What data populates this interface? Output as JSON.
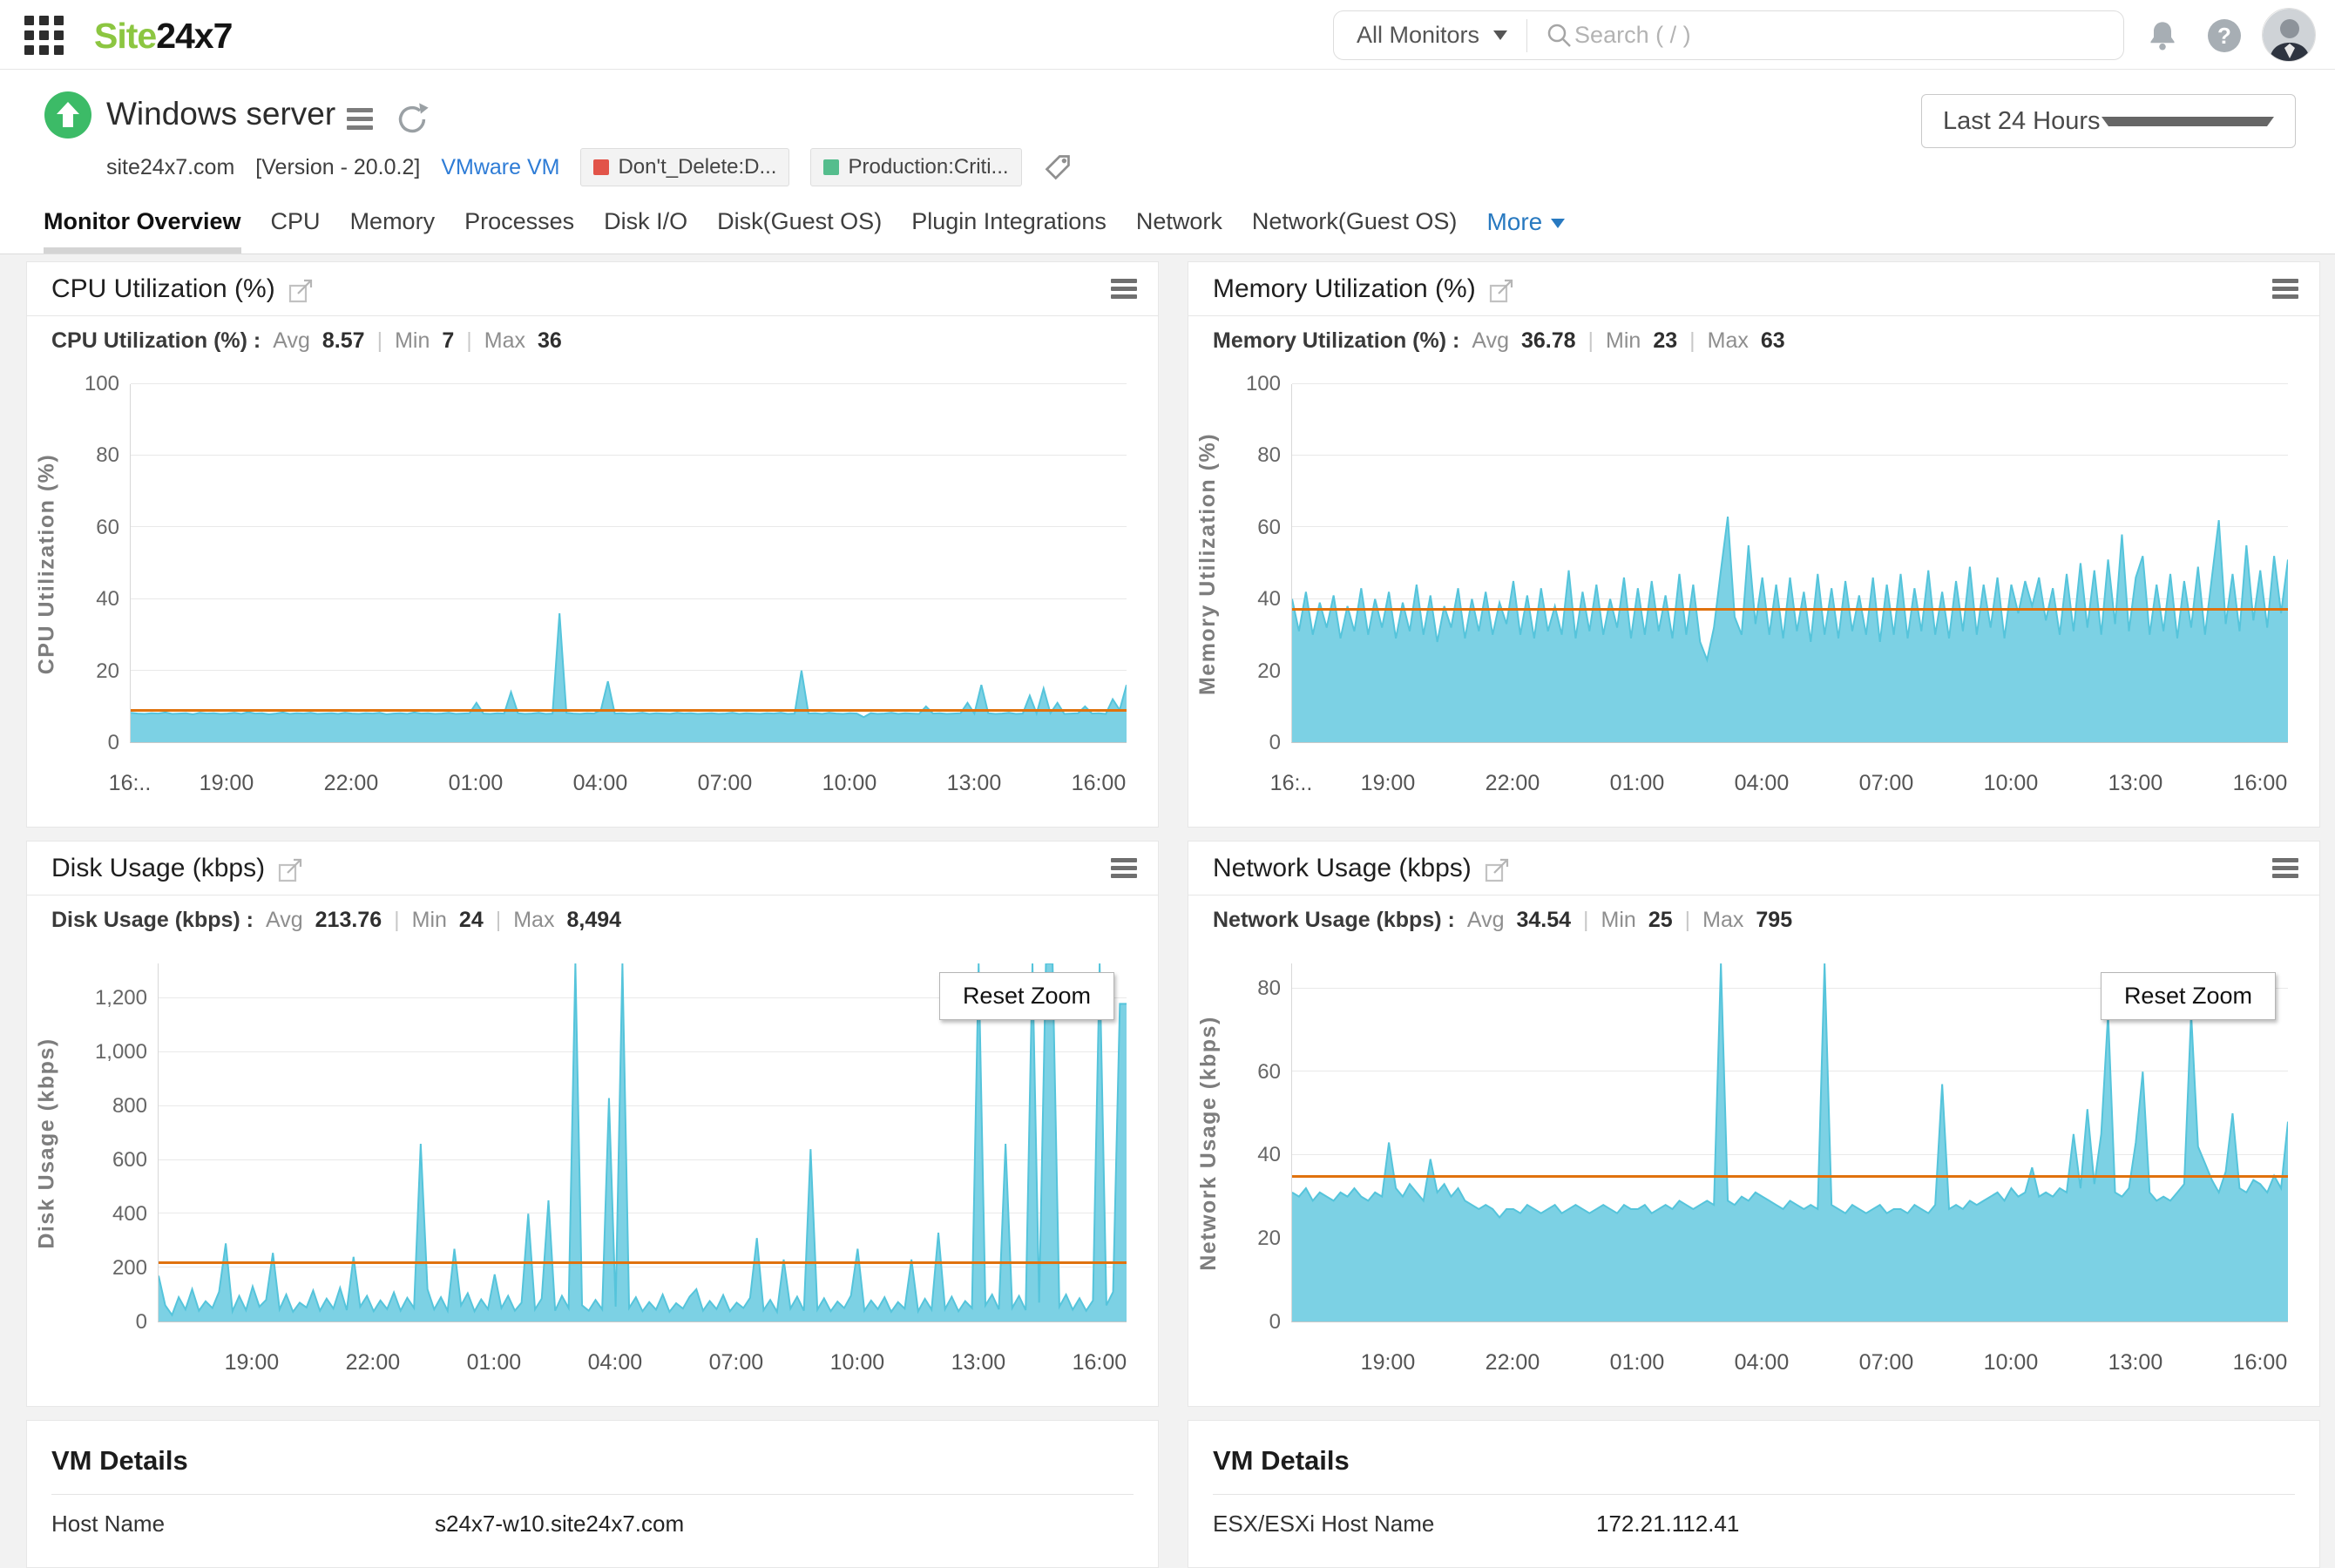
{
  "topbar": {
    "logo_site": "Site",
    "logo_24x7": "24x7",
    "monitors_label": "All Monitors",
    "search_placeholder": "Search ( / )"
  },
  "header": {
    "title": "Windows server",
    "host": "site24x7.com",
    "version": "[Version - 20.0.2]",
    "vm_type": "VMware VM",
    "tags": [
      {
        "label": "Don't_Delete:D...",
        "color": "#E25449"
      },
      {
        "label": "Production:Criti...",
        "color": "#55BD8D"
      }
    ],
    "time_range": "Last 24 Hours"
  },
  "tabs": {
    "items": [
      "Monitor Overview",
      "CPU",
      "Memory",
      "Processes",
      "Disk I/O",
      "Disk(Guest OS)",
      "Plugin Integrations",
      "Network",
      "Network(Guest OS)"
    ],
    "active": "Monitor Overview",
    "more_label": "More"
  },
  "ui": {
    "sep": "|",
    "reset_zoom": "Reset Zoom",
    "help_glyph": "?"
  },
  "colors": {
    "brand_green": "#8CC641",
    "status_up": "#3CBB67",
    "area_fill": "#7CD1E4",
    "area_stroke": "#55C4DB",
    "avg_line": "#E0720E",
    "tag_red": "#E25449",
    "tag_green": "#55BD8D",
    "link_blue": "#2E7CD6",
    "more_blue": "#2879C0"
  },
  "panels": [
    {
      "title": "CPU Utilization (%)",
      "stat_label": "CPU Utilization (%) :",
      "avg_label": "Avg",
      "avg": "8.57",
      "min_label": "Min",
      "min": "7",
      "max_label": "Max",
      "max": "36"
    },
    {
      "title": "Memory Utilization (%)",
      "stat_label": "Memory Utilization (%) :",
      "avg_label": "Avg",
      "avg": "36.78",
      "min_label": "Min",
      "min": "23",
      "max_label": "Max",
      "max": "63"
    },
    {
      "title": "Disk Usage (kbps)",
      "stat_label": "Disk Usage (kbps) :",
      "avg_label": "Avg",
      "avg": "213.76",
      "min_label": "Min",
      "min": "24",
      "max_label": "Max",
      "max": "8,494"
    },
    {
      "title": "Network Usage (kbps)",
      "stat_label": "Network Usage (kbps) :",
      "avg_label": "Avg",
      "avg": "34.54",
      "min_label": "Min",
      "min": "25",
      "max_label": "Max",
      "max": "795"
    }
  ],
  "vm_details": [
    {
      "title": "VM Details",
      "rows": [
        {
          "label": "Host Name",
          "value": "s24x7-w10.site24x7.com"
        }
      ]
    },
    {
      "title": "VM Details",
      "rows": [
        {
          "label": "ESX/ESXi Host Name",
          "value": "172.21.112.41"
        }
      ]
    }
  ],
  "chart_data": [
    {
      "type": "area",
      "title": "CPU Utilization (%)",
      "ylabel": "CPU Utilization (%)",
      "xlabel": "",
      "ylim": [
        0,
        100
      ],
      "yticks": [
        0,
        20,
        40,
        60,
        80,
        100
      ],
      "ytick_labels": [
        "0",
        "20",
        "40",
        "60",
        "80",
        "100"
      ],
      "xtick_labels": [
        "16:..",
        "19:00",
        "22:00",
        "01:00",
        "04:00",
        "07:00",
        "10:00",
        "13:00",
        "16:00"
      ],
      "xtick_fracs": [
        0,
        0.097,
        0.222,
        0.347,
        0.472,
        0.597,
        0.722,
        0.847,
        0.972
      ],
      "avg_line": 8.57,
      "grid": true,
      "legend": "none",
      "values": [
        8.2,
        8,
        7.9,
        8.1,
        8,
        8.3,
        7.9,
        8,
        8.1,
        7.8,
        8.2,
        8,
        8.1,
        7.9,
        8,
        8.2,
        7.9,
        8.4,
        8,
        8.1,
        7.8,
        8,
        8.3,
        7.9,
        8.1,
        8,
        8.2,
        7.9,
        8,
        8.1,
        7.9,
        8.2,
        8,
        7.9,
        8.1,
        8,
        8.2,
        7.8,
        8,
        8.1,
        7.9,
        8.3,
        8,
        8.1,
        7.9,
        8,
        8.2,
        7.9,
        8,
        8.1,
        11,
        8,
        7.9,
        8.1,
        8,
        14,
        8.1,
        7.9,
        8,
        8.2,
        7.9,
        8,
        36,
        8.2,
        8,
        7.9,
        8.1,
        8,
        9,
        17,
        8,
        8.1,
        7.9,
        8,
        8.2,
        7.9,
        8.1,
        8,
        7.9,
        8.2,
        8,
        8.1,
        7.9,
        8,
        8.1,
        7.9,
        8,
        8.2,
        7.9,
        8.1,
        8,
        7.9,
        8.1,
        8,
        8.2,
        7.9,
        8,
        20,
        8,
        8.1,
        7.9,
        8.2,
        8,
        7.9,
        8.1,
        8,
        7,
        8.1,
        7.9,
        8,
        8.2,
        7.9,
        8.1,
        8,
        7.9,
        10,
        8,
        8.1,
        7.9,
        8,
        8.1,
        11,
        8,
        16,
        8.1,
        7.9,
        8,
        8.2,
        7.9,
        8,
        13,
        8,
        15,
        8.1,
        11,
        7.9,
        8,
        8.1,
        10,
        8,
        8.1,
        7.9,
        12,
        9,
        16
      ]
    },
    {
      "type": "area",
      "title": "Memory Utilization (%)",
      "ylabel": "Memory Utilization (%)",
      "xlabel": "",
      "ylim": [
        0,
        100
      ],
      "yticks": [
        0,
        20,
        40,
        60,
        80,
        100
      ],
      "ytick_labels": [
        "0",
        "20",
        "40",
        "60",
        "80",
        "100"
      ],
      "xtick_labels": [
        "16:..",
        "19:00",
        "22:00",
        "01:00",
        "04:00",
        "07:00",
        "10:00",
        "13:00",
        "16:00"
      ],
      "xtick_fracs": [
        0,
        0.097,
        0.222,
        0.347,
        0.472,
        0.597,
        0.722,
        0.847,
        0.972
      ],
      "avg_line": 36.78,
      "grid": true,
      "legend": "none",
      "values": [
        40,
        31,
        42,
        30,
        39,
        32,
        41,
        29,
        38,
        31,
        43,
        30,
        40,
        32,
        42,
        29,
        39,
        31,
        44,
        30,
        41,
        28,
        38,
        32,
        43,
        29,
        40,
        31,
        42,
        30,
        39,
        33,
        45,
        30,
        41,
        29,
        43,
        31,
        38,
        30,
        48,
        29,
        42,
        31,
        44,
        30,
        40,
        32,
        46,
        29,
        43,
        30,
        45,
        31,
        41,
        29,
        47,
        30,
        44,
        28,
        23,
        32,
        48,
        63,
        35,
        30,
        55,
        33,
        46,
        30,
        44,
        29,
        46,
        31,
        42,
        28,
        47,
        30,
        43,
        29,
        45,
        31,
        41,
        30,
        46,
        28,
        44,
        30,
        47,
        29,
        43,
        31,
        48,
        30,
        42,
        29,
        45,
        31,
        49,
        30,
        44,
        32,
        46,
        29,
        44,
        36,
        45,
        38,
        46,
        34,
        43,
        30,
        47,
        31,
        50,
        32,
        48,
        30,
        51,
        33,
        58,
        31,
        46,
        52,
        30,
        44,
        31,
        47,
        29,
        45,
        32,
        49,
        30,
        46,
        62,
        33,
        47,
        31,
        55,
        34,
        48,
        32,
        52,
        36,
        51
      ]
    },
    {
      "type": "area",
      "title": "Disk Usage (kbps)",
      "ylabel": "Disk Usage (kbps)",
      "xlabel": "",
      "ylim": [
        0,
        1330
      ],
      "yticks": [
        0,
        200,
        400,
        600,
        800,
        1000,
        1200
      ],
      "ytick_labels": [
        "0",
        "200",
        "400",
        "600",
        "800",
        "1,000",
        "1,200"
      ],
      "xtick_labels": [
        "19:00",
        "22:00",
        "01:00",
        "04:00",
        "07:00",
        "10:00",
        "13:00",
        "16:00"
      ],
      "xtick_fracs": [
        0.097,
        0.222,
        0.347,
        0.472,
        0.597,
        0.722,
        0.847,
        0.972
      ],
      "avg_line": 213.76,
      "grid": true,
      "legend": "none",
      "zoomed": true,
      "values": [
        170,
        60,
        24,
        90,
        45,
        120,
        40,
        75,
        50,
        110,
        290,
        38,
        95,
        42,
        130,
        55,
        80,
        255,
        45,
        100,
        36,
        70,
        52,
        115,
        40,
        85,
        48,
        125,
        42,
        240,
        55,
        95,
        38,
        78,
        46,
        108,
        40,
        88,
        50,
        660,
        120,
        45,
        90,
        40,
        270,
        60,
        105,
        38,
        82,
        46,
        175,
        50,
        95,
        40,
        70,
        400,
        45,
        85,
        450,
        40,
        95,
        50,
        8494,
        60,
        40,
        80,
        45,
        830,
        55,
        4200,
        50,
        90,
        38,
        72,
        44,
        100,
        36,
        68,
        48,
        92,
        120,
        40,
        76,
        46,
        98,
        38,
        70,
        50,
        88,
        310,
        42,
        80,
        36,
        230,
        48,
        92,
        40,
        640,
        44,
        86,
        38,
        74,
        50,
        96,
        270,
        40,
        78,
        46,
        90,
        36,
        72,
        48,
        230,
        38,
        84,
        44,
        330,
        46,
        92,
        38,
        76,
        50,
        2600,
        60,
        100,
        45,
        660,
        50,
        95,
        42,
        3400,
        70,
        2200,
        1900,
        55,
        100,
        44,
        86,
        40,
        78,
        2800,
        60,
        110,
        1180,
        1180
      ]
    },
    {
      "type": "area",
      "title": "Network Usage (kbps)",
      "ylabel": "Network Usage (kbps)",
      "xlabel": "",
      "ylim": [
        0,
        86
      ],
      "yticks": [
        0,
        20,
        40,
        60,
        80
      ],
      "ytick_labels": [
        "0",
        "20",
        "40",
        "60",
        "80"
      ],
      "xtick_labels": [
        "19:00",
        "22:00",
        "01:00",
        "04:00",
        "07:00",
        "10:00",
        "13:00",
        "16:00"
      ],
      "xtick_fracs": [
        0.097,
        0.222,
        0.347,
        0.472,
        0.597,
        0.722,
        0.847,
        0.972
      ],
      "avg_line": 34.54,
      "grid": true,
      "legend": "none",
      "zoomed": true,
      "values": [
        31,
        30,
        32,
        29,
        31,
        30,
        29,
        31,
        30,
        32,
        30,
        29,
        31,
        30,
        43,
        32,
        30,
        33,
        31,
        29,
        39,
        31,
        33,
        30,
        32,
        29,
        28,
        27,
        28,
        27,
        25,
        27,
        27,
        26,
        28,
        27,
        26,
        27,
        28,
        26,
        27,
        28,
        27,
        26,
        27,
        28,
        27,
        26,
        28,
        27,
        27,
        28,
        26,
        27,
        28,
        27,
        29,
        28,
        27,
        28,
        29,
        28,
        795,
        29,
        28,
        30,
        29,
        31,
        30,
        29,
        28,
        27,
        29,
        28,
        27,
        28,
        27,
        795,
        28,
        27,
        26,
        28,
        27,
        26,
        27,
        28,
        26,
        27,
        27,
        26,
        28,
        27,
        26,
        28,
        57,
        27,
        28,
        27,
        29,
        28,
        29,
        30,
        31,
        29,
        32,
        30,
        31,
        37,
        30,
        31,
        30,
        32,
        31,
        45,
        32,
        51,
        33,
        45,
        74,
        31,
        30,
        32,
        43,
        60,
        31,
        29,
        30,
        29,
        31,
        33,
        74,
        42,
        38,
        34,
        31,
        36,
        50,
        32,
        31,
        34,
        33,
        31,
        35,
        32,
        48
      ]
    }
  ]
}
